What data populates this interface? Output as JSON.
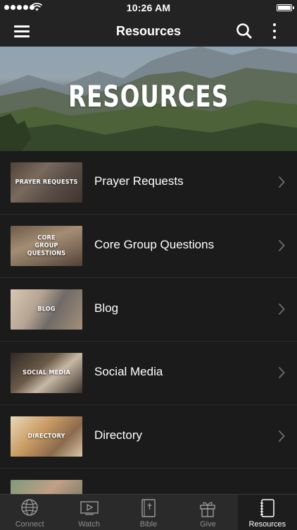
{
  "status_bar": {
    "time": "10:26 AM"
  },
  "nav": {
    "title": "Resources"
  },
  "hero": {
    "title": "RESOURCES"
  },
  "list": [
    {
      "thumb_label": "PRAYER REQUESTS",
      "label": "Prayer Requests"
    },
    {
      "thumb_label": "CORE GROUP QUESTIONS",
      "label": "Core Group Questions"
    },
    {
      "thumb_label": "BLOG",
      "label": "Blog"
    },
    {
      "thumb_label": "SOCIAL MEDIA",
      "label": "Social Media"
    },
    {
      "thumb_label": "DIRECTORY",
      "label": "Directory"
    },
    {
      "thumb_label": "",
      "label": ""
    }
  ],
  "tabs": [
    {
      "label": "Connect",
      "icon": "globe-icon"
    },
    {
      "label": "Watch",
      "icon": "play-icon"
    },
    {
      "label": "Bible",
      "icon": "bible-icon"
    },
    {
      "label": "Give",
      "icon": "gift-icon"
    },
    {
      "label": "Resources",
      "icon": "notebook-icon",
      "active": true
    }
  ],
  "colors": {
    "background": "#1b1b1b",
    "bar": "#232323",
    "tab_bar": "#2a2a2a",
    "inactive_tab": "#8e8e8e"
  }
}
